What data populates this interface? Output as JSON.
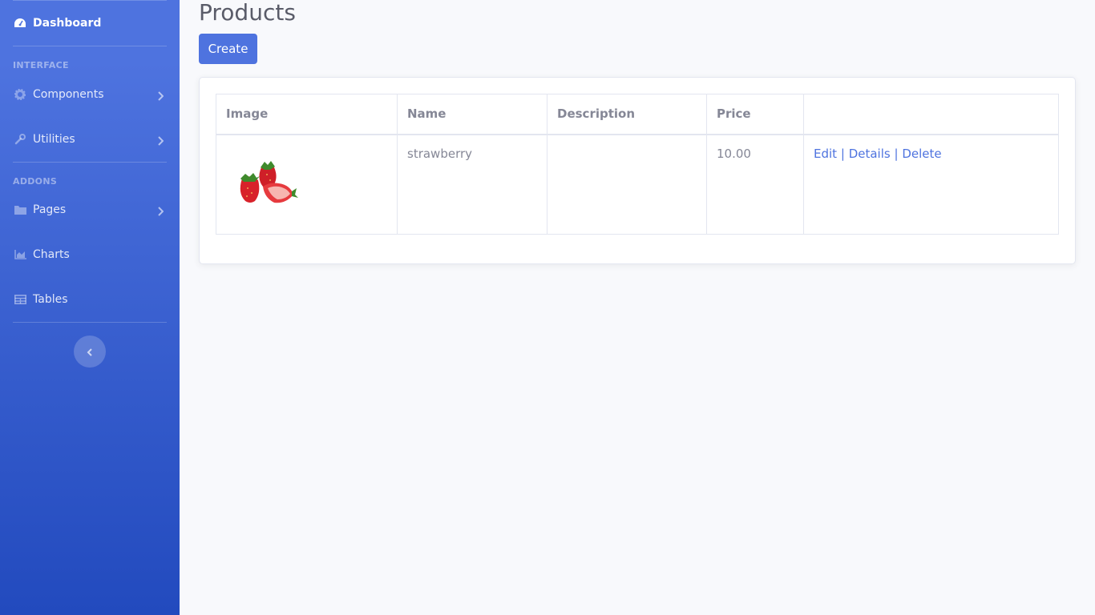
{
  "sidebar": {
    "dashboard": {
      "label": "Dashboard",
      "icon": "tachometer-icon"
    },
    "heading_interface": "Interface",
    "components": {
      "label": "Components",
      "icon": "gear-icon"
    },
    "utilities": {
      "label": "Utilities",
      "icon": "wrench-icon"
    },
    "heading_addons": "Addons",
    "pages": {
      "label": "Pages",
      "icon": "folder-icon"
    },
    "charts": {
      "label": "Charts",
      "icon": "chart-area-icon"
    },
    "tables": {
      "label": "Tables",
      "icon": "table-icon"
    },
    "toggle_icon": "chevron-left-icon"
  },
  "main": {
    "title": "Products",
    "create_label": "Create",
    "table": {
      "headers": [
        "Image",
        "Name",
        "Description",
        "Price",
        ""
      ],
      "rows": [
        {
          "image": "strawberry-image",
          "name": "strawberry",
          "description": "",
          "price": "10.00",
          "actions": {
            "edit": "Edit",
            "separator": "|",
            "details": "Details",
            "delete": "Delete"
          }
        }
      ]
    }
  },
  "colors": {
    "primary": "#4e73df",
    "sidebar_gradient_start": "#4e73df",
    "sidebar_gradient_end": "#224abe",
    "background": "#f8f9fc",
    "text_muted": "#858796"
  }
}
